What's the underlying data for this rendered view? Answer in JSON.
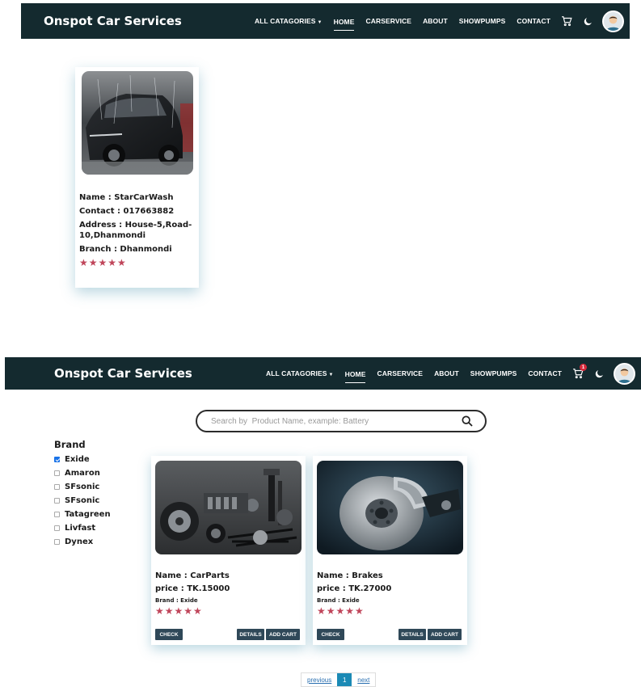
{
  "navbar": {
    "brand": "Onspot Car Services",
    "links": [
      "ALL CATAGORIES",
      "HOME",
      "CARSERVICE",
      "ABOUT",
      "SHOWPUMPS",
      "CONTACT"
    ],
    "cart_badge": "1",
    "icons": [
      "cart-icon",
      "moon-icon",
      "avatar"
    ]
  },
  "shop_card": {
    "name": "Name : StarCarWash",
    "contact": "Contact : 017663882",
    "address": "Address : House-5,Road-10,Dhanmondi",
    "branch": "Branch : Dhanmondi",
    "rating": 5,
    "stars": "★★★★★"
  },
  "search": {
    "placeholder": "Search by  Product Name, example: Battery"
  },
  "filter": {
    "title": "Brand",
    "brands": [
      {
        "label": "Exide",
        "checked": true
      },
      {
        "label": "Amaron",
        "checked": false
      },
      {
        "label": "SFsonic",
        "checked": false
      },
      {
        "label": "SFsonic",
        "checked": false
      },
      {
        "label": "Tatagreen",
        "checked": false
      },
      {
        "label": "Livfast",
        "checked": false
      },
      {
        "label": "Dynex",
        "checked": false
      }
    ]
  },
  "products": [
    {
      "name": "Name : CarParts",
      "price": "price : TK.15000",
      "brand": "Brand : Exide",
      "rating": 5,
      "stars": "★★★★★"
    },
    {
      "name": "Name : Brakes",
      "price": "price : TK.27000",
      "brand": "Brand : Exide",
      "rating": 5,
      "stars": "★★★★★"
    }
  ],
  "buttons": {
    "check": "CHECK",
    "details": "DETAILS",
    "add_cart": "ADD CART"
  },
  "pagination": {
    "previous": "previous",
    "current": "1",
    "next": "next"
  },
  "colors": {
    "navbar_bg": "#142a2f",
    "star": "#c0455a",
    "button_bg": "#2f4858",
    "page_active": "#1b8ab5",
    "checkbox_checked": "#1a73e8"
  }
}
